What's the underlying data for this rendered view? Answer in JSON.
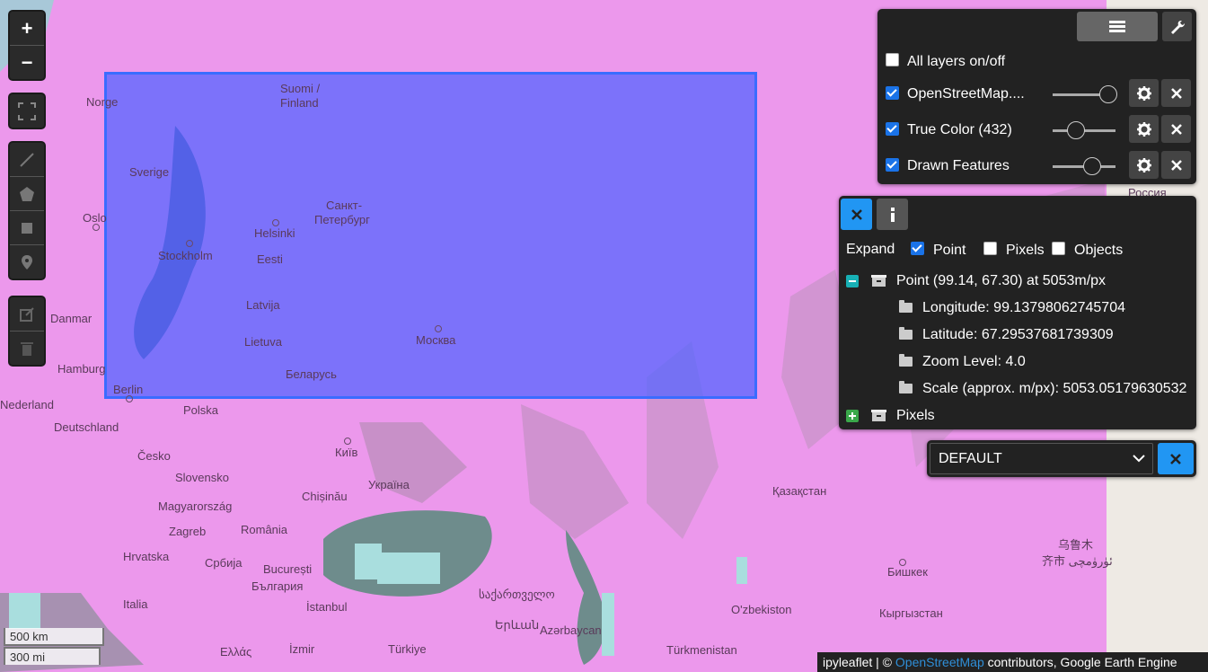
{
  "zoom_controls": {
    "zoom_in": "+",
    "zoom_out": "−"
  },
  "map_labels": {
    "norge": "Norge",
    "sverige": "Sverige",
    "suomi": "Suomi /",
    "finland": "Finland",
    "oslo": "Oslo",
    "stockholm": "Stockholm",
    "helsinki": "Helsinki",
    "spb1": "Санкт-",
    "spb2": "Петербург",
    "eesti": "Eesti",
    "latvija": "Latvija",
    "lietuva": "Lietuva",
    "moskva": "Москва",
    "belarus": "Беларусь",
    "danmark": "Danmar",
    "hamburg": "Hamburg",
    "berlin": "Berlin",
    "nederland": "Nederland",
    "polska": "Polska",
    "deutschland": "Deutschland",
    "cesko": "Česko",
    "kyiv": "Київ",
    "slovensko": "Slovensko",
    "ukraina": "Україна",
    "magyar": "Magyarország",
    "chisinau": "Chișinău",
    "romania": "România",
    "zagreb": "Zagreb",
    "hrvatska": "Hrvatska",
    "srbija": "Србија",
    "bucuresti": "București",
    "bulgaria": "България",
    "italia": "Italia",
    "istanbul": "İstanbul",
    "georgia": "საქართველო",
    "armenia": "Երևան",
    "azerbaijan": "Azərbaycan",
    "izmir": "İzmir",
    "turkiye": "Türkiye",
    "ellas": "Ελλάς",
    "turkmenistan": "Türkmenistan",
    "ozbekiston": "O'zbekiston",
    "kazakhstan": "Қазақстан",
    "kyrgyzstan": "Кыргызстан",
    "bishkek": "Бишкек",
    "urumqi1": "乌鲁木",
    "urumqi2": "齐市 ئۈرۈمچى",
    "rossiya": "Россия"
  },
  "layers_panel": {
    "all_layers_label": "All layers on/off",
    "all_layers_checked": false,
    "layers": [
      {
        "name": "OpenStreetMap....",
        "checked": true,
        "opacity": 1.0
      },
      {
        "name": "True Color (432)",
        "checked": true,
        "opacity": 0.3
      },
      {
        "name": "Drawn Features",
        "checked": true,
        "opacity": 0.65
      }
    ]
  },
  "inspector": {
    "expand_label": "Expand",
    "options": [
      {
        "label": "Point",
        "checked": true
      },
      {
        "label": "Pixels",
        "checked": false
      },
      {
        "label": "Objects",
        "checked": false
      }
    ],
    "point_header": "Point (99.14, 67.30) at 5053m/px",
    "longitude": "Longitude: 99.13798062745704",
    "latitude": "Latitude: 67.29537681739309",
    "zoom_level": "Zoom Level: 4.0",
    "scale": "Scale (approx. m/px): 5053.05179630532",
    "pixels_header": "Pixels"
  },
  "basemap_select": {
    "value": "DEFAULT"
  },
  "scale_bar": {
    "km": "500 km",
    "mi": "300 mi"
  },
  "attribution": {
    "prefix": "ipyleaflet | © ",
    "link": "OpenStreetMap",
    "suffix": " contributors, Google Earth Engine"
  },
  "colors": {
    "drawn_rect": "#5a6cff",
    "accent": "#2196f3",
    "panel": "#222222"
  }
}
